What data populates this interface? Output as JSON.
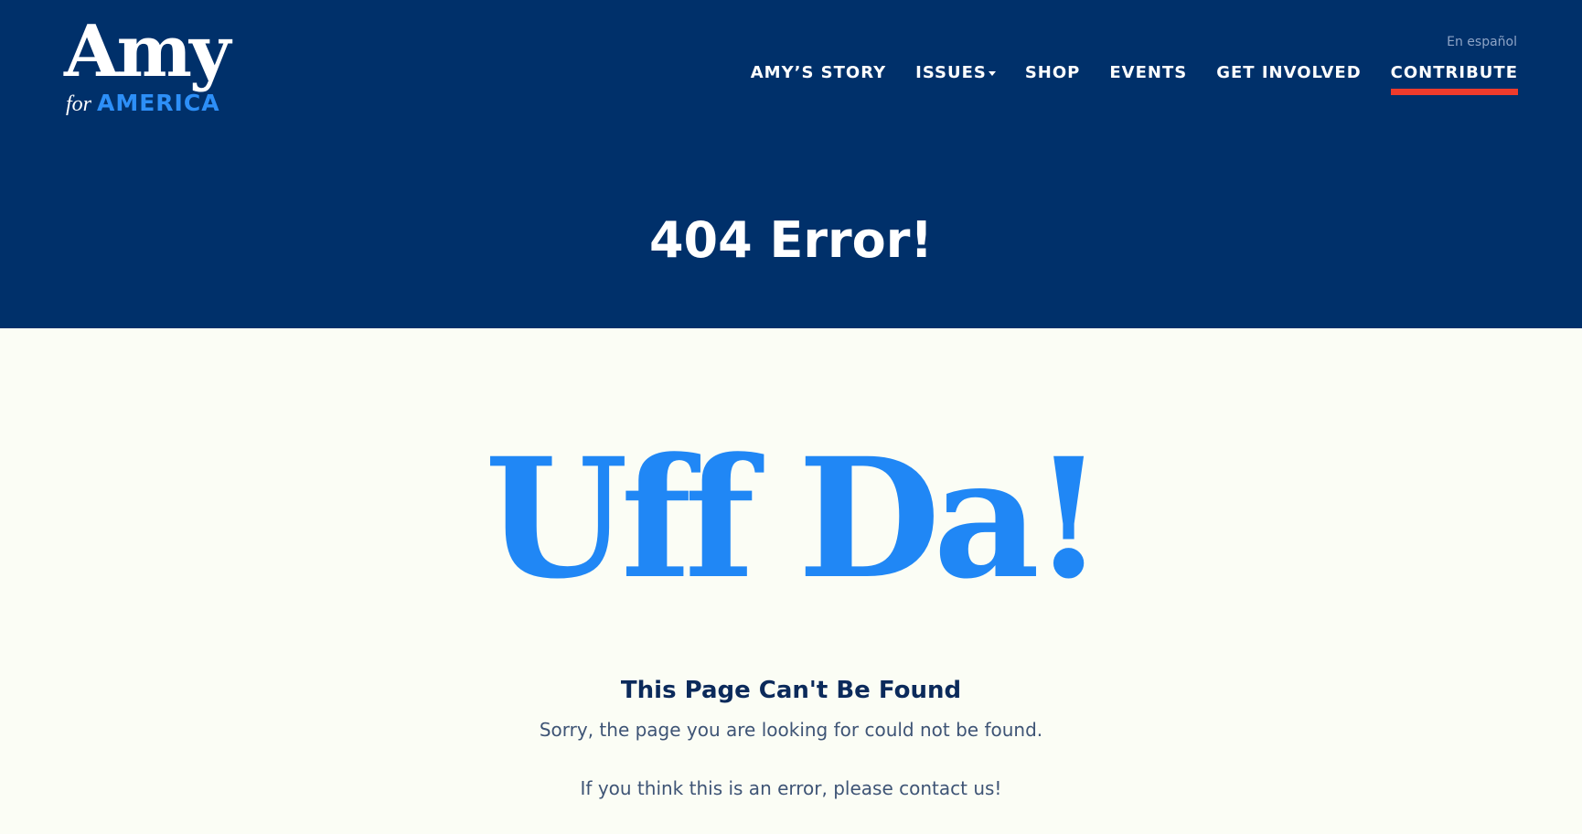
{
  "header": {
    "logo": {
      "title": "Amy",
      "for": "for",
      "america": "AMERICA"
    },
    "lang_link": "En español",
    "nav": {
      "story": "AMY’S STORY",
      "issues": "ISSUES",
      "shop": "SHOP",
      "events": "EVENTS",
      "get_involved": "GET INVOLVED",
      "contribute": "CONTRIBUTE"
    },
    "heading": "404 Error!"
  },
  "main": {
    "big_title": "Uff Da!",
    "subtitle": "This Page Can't Be Found",
    "message_1": "Sorry, the page you are looking for could not be found.",
    "message_2": "If you think this is an error, please contact us!"
  },
  "colors": {
    "navy": "#00306a",
    "blue_accent": "#2087f5",
    "red_accent": "#ee3b2c",
    "background": "#fbfdf5"
  }
}
